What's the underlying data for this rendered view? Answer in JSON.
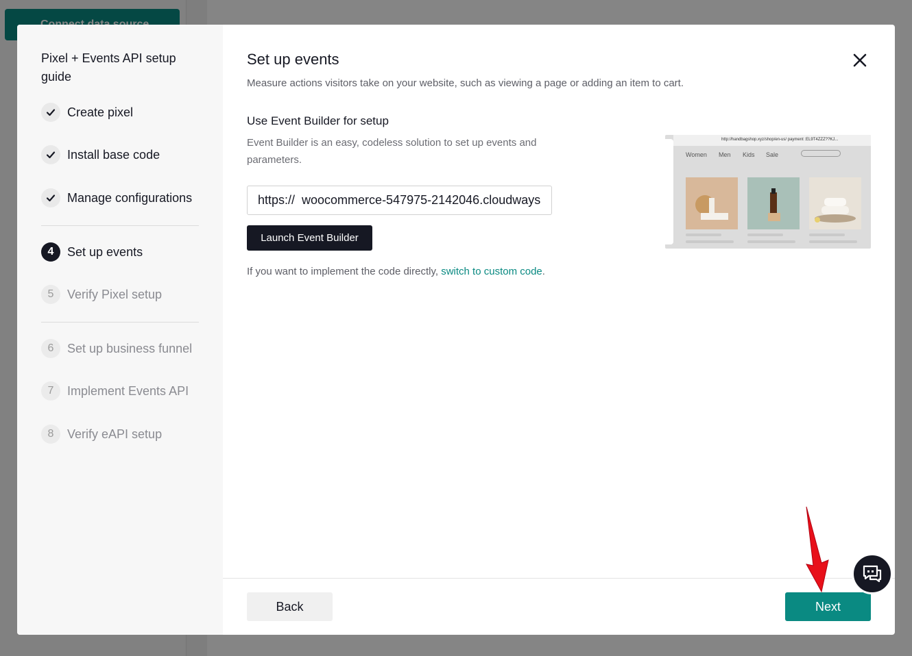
{
  "background": {
    "connect_button_label": "Connect data source"
  },
  "guide": {
    "title": "Pixel + Events API setup guide",
    "steps": [
      {
        "marker": "✓",
        "label": "Create pixel",
        "state": "done"
      },
      {
        "marker": "✓",
        "label": "Install base code",
        "state": "done"
      },
      {
        "marker": "✓",
        "label": "Manage configurations",
        "state": "done"
      },
      {
        "marker": "4",
        "label": "Set up events",
        "state": "current"
      },
      {
        "marker": "5",
        "label": "Verify Pixel setup",
        "state": "todo"
      },
      {
        "marker": "6",
        "label": "Set up business funnel",
        "state": "todo"
      },
      {
        "marker": "7",
        "label": "Implement Events API",
        "state": "todo"
      },
      {
        "marker": "8",
        "label": "Verify eAPI setup",
        "state": "todo"
      }
    ]
  },
  "main": {
    "title": "Set up events",
    "subtitle": "Measure actions visitors take on your website, such as viewing a page or adding an item to cart.",
    "section_heading": "Use Event Builder for setup",
    "section_description": "Event Builder is an easy, codeless solution to set up events and parameters.",
    "url_input_value": "https://  woocommerce-547975-2142046.cloudways",
    "launch_button_label": "Launch Event Builder",
    "custom_code_prefix": "If you want to implement the code directly, ",
    "custom_code_link": "switch to custom code",
    "custom_code_suffix": "."
  },
  "preview": {
    "url_text": "http://handbagshop.xyz/shop/en-us/ payment :EL9T4ZZZ??KJ...",
    "nav_items": [
      "Women",
      "Men",
      "Kids",
      "Sale"
    ]
  },
  "footer": {
    "back_label": "Back",
    "next_label": "Next"
  },
  "colors": {
    "accent": "#0a8a82",
    "dark": "#161823",
    "annotation_arrow": "#e8101a"
  }
}
